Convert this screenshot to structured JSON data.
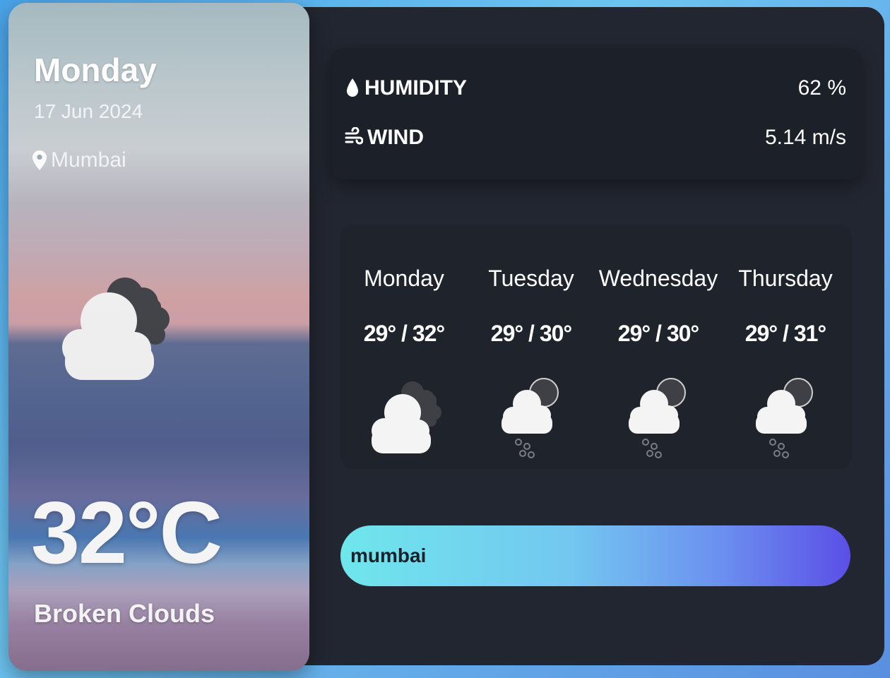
{
  "today": {
    "day": "Monday",
    "date": "17 Jun 2024",
    "location": "Mumbai",
    "temperature": "32°C",
    "description": "Broken Clouds",
    "icon": "broken-clouds-icon"
  },
  "stats": {
    "humidity_label": "HUMIDITY",
    "humidity_value": "62 %",
    "wind_label": "WIND",
    "wind_value": "5.14 m/s"
  },
  "forecast": [
    {
      "day": "Monday",
      "temps": "29° / 32°",
      "icon": "broken-clouds-icon"
    },
    {
      "day": "Tuesday",
      "temps": "29° / 30°",
      "icon": "rain-clouds-icon"
    },
    {
      "day": "Wednesday",
      "temps": "29° / 30°",
      "icon": "rain-clouds-icon"
    },
    {
      "day": "Thursday",
      "temps": "29° / 31°",
      "icon": "rain-clouds-icon"
    }
  ],
  "search": {
    "value": "mumbai"
  },
  "colors": {
    "panel": "#222630",
    "card": "#1c2029",
    "search_gradient_start": "#6fe6ec",
    "search_gradient_end": "#5b4fe6"
  }
}
